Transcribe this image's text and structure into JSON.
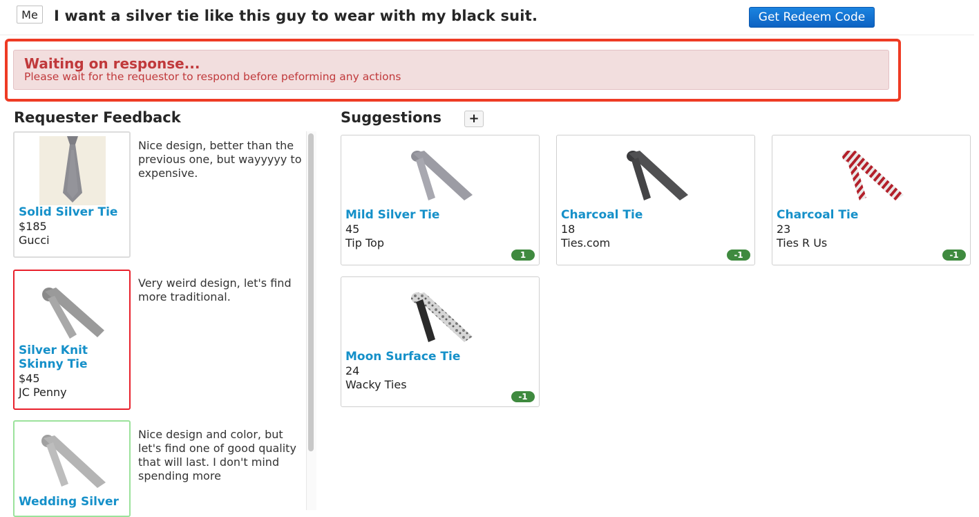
{
  "header": {
    "me_label": "Me",
    "request_text": "I want a silver tie like this guy to wear with my black suit.",
    "redeem_button": "Get Redeem Code"
  },
  "alert": {
    "title": "Waiting on response...",
    "message": "Please wait for the requestor to respond before peforming any actions"
  },
  "feedback": {
    "heading": "Requester Feedback",
    "items": [
      {
        "name": "Solid Silver Tie",
        "price": "$185",
        "store": "Gucci",
        "comment": "Nice design, better than the previous one, but wayyyyy to expensive.",
        "status": "neutral"
      },
      {
        "name_line1": "Silver Knit",
        "name_line2": "Skinny Tie",
        "price": "$45",
        "store": "JC Penny",
        "comment": "Very weird design, let's find more traditional.",
        "status": "rejected"
      },
      {
        "name": "Wedding Silver",
        "comment": "Nice design and color, but let's find one of good quality that will last. I don't mind spending more",
        "status": "liked"
      }
    ]
  },
  "suggestions": {
    "heading": "Suggestions",
    "add_button": "+",
    "items": [
      {
        "name": "Mild Silver Tie",
        "price": "45",
        "store": "Tip Top",
        "votes": "1",
        "tie": "silver"
      },
      {
        "name": "Charcoal Tie",
        "price": "18",
        "store": "Ties.com",
        "votes": "-1",
        "tie": "charcoal"
      },
      {
        "name": "Charcoal Tie",
        "price": "23",
        "store": "Ties R Us",
        "votes": "-1",
        "tie": "red-striped"
      },
      {
        "name": "Moon Surface Tie",
        "price": "24",
        "store": "Wacky Ties",
        "votes": "-1",
        "tie": "moon"
      }
    ]
  },
  "colors": {
    "link": "#1590c9",
    "alert_bg": "#f2dede",
    "alert_text": "#c0393b",
    "highlight": "#ee3b24",
    "reject_border": "#e8202b",
    "like_border": "#9be29b",
    "badge": "#3f8a3f",
    "button": "#0d62c2"
  }
}
